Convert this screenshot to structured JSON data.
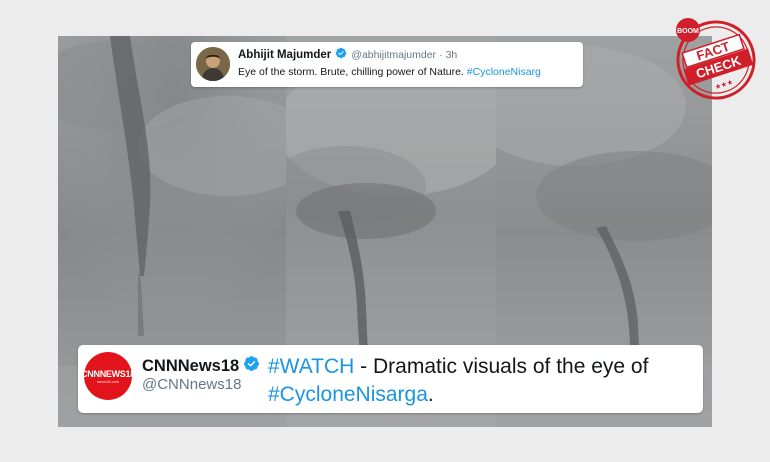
{
  "top_tweet": {
    "name": "Abhijit Majumder",
    "handle": "@abhijitmajumder",
    "separator": "·",
    "time": "3h",
    "text_plain": "Eye of the storm. Brute, chilling power of Nature. ",
    "hashtag": "#CycloneNisarg",
    "verified_icon": "verified-badge"
  },
  "bottom_tweet": {
    "name": "CNNNews18",
    "handle": "@CNNnews18",
    "hashtag_watch": "#WATCH",
    "text_middle": " - Dramatic visuals of the eye of ",
    "hashtag_cyclone": "#CycloneNisarga",
    "text_end": ".",
    "avatar_logo": "CNNNEWS18",
    "avatar_sub": "news18.com",
    "verified_icon": "verified-badge"
  },
  "stamp": {
    "top_word": "BOOM",
    "line1": "FACT",
    "line2": "CHECK",
    "stars": "★★★"
  },
  "colors": {
    "background": "#ececec",
    "hashtag": "#1b95e0",
    "verified": "#1da1f2",
    "cnn_red": "#e2131a",
    "stamp_red": "#d01f2a"
  }
}
